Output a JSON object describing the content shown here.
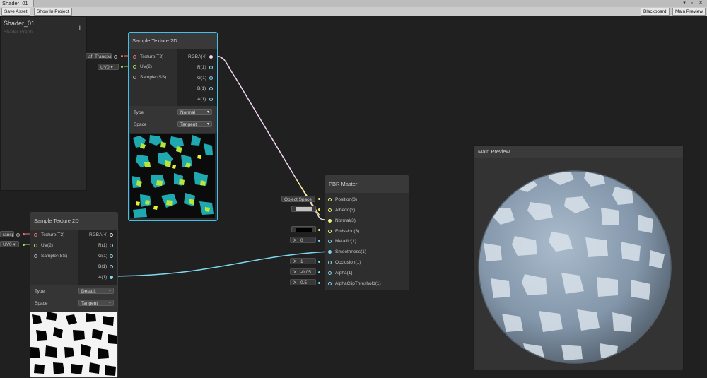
{
  "window": {
    "tab_title": "Shader_01",
    "controls": "▾ ▫ ✕"
  },
  "toolbar": {
    "save_asset": "Save Asset",
    "show_in_project": "Show In Project",
    "blackboard": "Blackboard",
    "main_preview": "Main Preview"
  },
  "blackboard": {
    "title": "Shader_01",
    "subtitle": "Shader Graph",
    "add": "+"
  },
  "props": {
    "texture_top": "af_Transpa",
    "uv_top": "UV0",
    "texture_bottom": "ranspa",
    "uv_bottom": "UV0"
  },
  "node_top": {
    "title": "Sample Texture 2D",
    "inputs": [
      "Texture(T2)",
      "UV(2)",
      "Sampler(SS)"
    ],
    "outputs": [
      "RGBA(4)",
      "R(1)",
      "G(1)",
      "B(1)",
      "A(1)"
    ],
    "type_label": "Type",
    "type_value": "Normal",
    "space_label": "Space",
    "space_value": "Tangent"
  },
  "node_bottom": {
    "title": "Sample Texture 2D",
    "inputs": [
      "Texture(T2)",
      "UV(2)",
      "Sampler(SS)"
    ],
    "outputs": [
      "RGBA(4)",
      "R(1)",
      "G(1)",
      "B(1)",
      "A(1)"
    ],
    "type_label": "Type",
    "type_value": "Default",
    "space_label": "Space",
    "space_value": "Tangent"
  },
  "pbr": {
    "title": "PBR Master",
    "inputs": [
      "Position(3)",
      "Albedo(3)",
      "Normal(3)",
      "Emission(3)",
      "Metallic(1)",
      "Smoothness(1)",
      "Occlusion(1)",
      "Alpha(1)",
      "AlphaClipThreshold(1)"
    ],
    "position_space": "Object Space",
    "metallic": "0",
    "occlusion": "1",
    "alpha": "-0.05",
    "alpha_clip": "0.5",
    "vec_x": "X"
  },
  "preview": {
    "title": "Main Preview"
  },
  "colors": {
    "texture_pin": "#e87478",
    "uv_pin": "#9ce46a",
    "vector4": "#f2d7f0",
    "vector3": "#f5f37a",
    "vector1": "#80d8f0",
    "selection": "#44c0ea"
  }
}
